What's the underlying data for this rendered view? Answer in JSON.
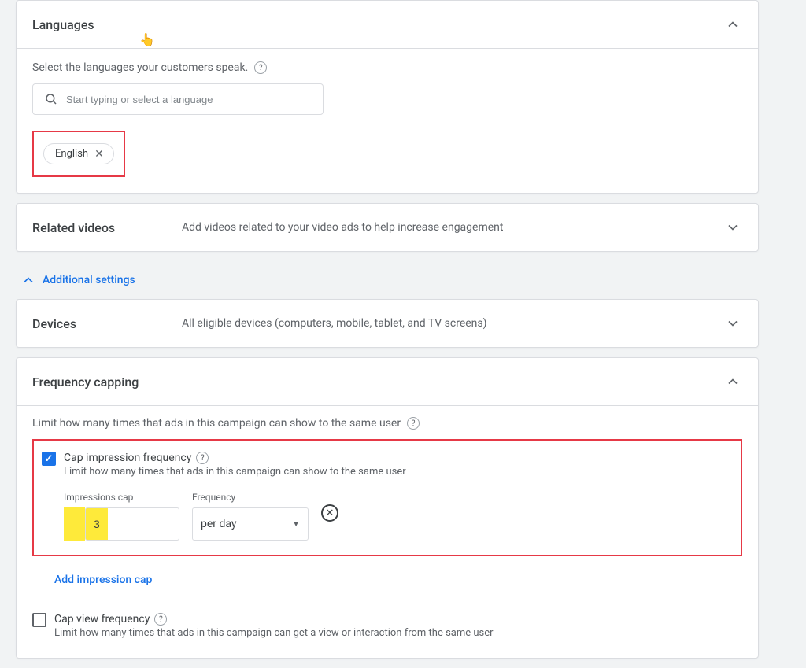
{
  "languages": {
    "title": "Languages",
    "help_text": "Select the languages your customers speak.",
    "search_placeholder": "Start typing or select a language",
    "chip": "English"
  },
  "related": {
    "title": "Related videos",
    "desc": "Add videos related to your video ads to help increase engagement"
  },
  "additional_label": "Additional settings",
  "devices": {
    "title": "Devices",
    "desc": "All eligible devices (computers, mobile, tablet, and TV screens)"
  },
  "freq": {
    "title": "Frequency capping",
    "help_text": "Limit how many times that ads in this campaign can show to the same user",
    "cap_impression_label": "Cap impression frequency",
    "cap_impression_sub": "Limit how many times that ads in this campaign can show to the same user",
    "impressions_label": "Impressions cap",
    "impressions_value": "3",
    "frequency_label": "Frequency",
    "frequency_value": "per day",
    "add_link": "Add impression cap",
    "cap_view_label": "Cap view frequency",
    "cap_view_sub": "Limit how many times that ads in this campaign can get a view or interaction from the same user"
  }
}
